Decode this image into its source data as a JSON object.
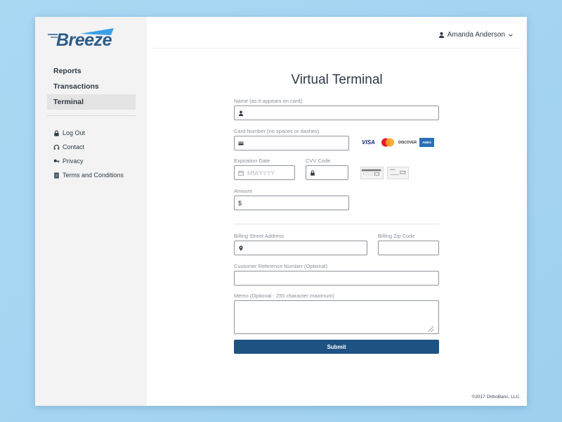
{
  "brand": {
    "logo_text": "Breeze",
    "accent_color": "#2a5a8a",
    "swoosh_color": "#3aa0e6"
  },
  "sidebar": {
    "nav": [
      {
        "label": "Reports",
        "active": false
      },
      {
        "label": "Transactions",
        "active": false
      },
      {
        "label": "Terminal",
        "active": true
      }
    ],
    "links": [
      {
        "label": "Log Out",
        "icon": "lock-icon"
      },
      {
        "label": "Contact",
        "icon": "headset-icon"
      },
      {
        "label": "Privacy",
        "icon": "key-icon"
      },
      {
        "label": "Terms and Conditions",
        "icon": "document-icon"
      }
    ]
  },
  "header": {
    "user_name": "Amanda Anderson"
  },
  "page": {
    "title": "Virtual Terminal"
  },
  "form": {
    "name": {
      "label": "Name (as it appears on card)",
      "value": ""
    },
    "card_number": {
      "label": "Card Number (no spaces or dashes)",
      "value": ""
    },
    "card_brands": [
      "VISA",
      "MasterCard",
      "DISCOVER",
      "AMEX"
    ],
    "expiration": {
      "label": "Expiration Date",
      "placeholder": "MM/YYYY"
    },
    "cvv": {
      "label": "CVV Code",
      "value": ""
    },
    "amount": {
      "label": "Amount",
      "prefix": "$"
    },
    "billing_street": {
      "label": "Billing Street Address",
      "value": ""
    },
    "billing_zip": {
      "label": "Billing Zip Code",
      "value": ""
    },
    "customer_ref": {
      "label": "Customer Reference Number (Optional)",
      "value": ""
    },
    "memo": {
      "label": "Memo (Optional - 255 character maximum)",
      "value": ""
    },
    "submit_label": "Submit",
    "submit_color": "#1d5282"
  },
  "footer": {
    "copyright": "©2017 OrthoBanc, LLC."
  }
}
